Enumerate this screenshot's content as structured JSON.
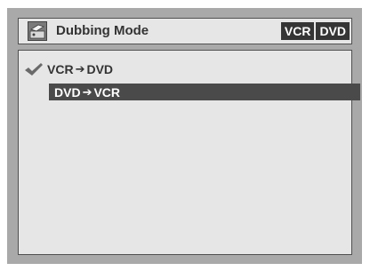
{
  "header": {
    "title": "Dubbing Mode",
    "icon": "dubbing-icon",
    "badges": [
      "VCR",
      "DVD"
    ]
  },
  "options": [
    {
      "from": "VCR",
      "to": "DVD",
      "arrow": "➔",
      "checked": true,
      "highlighted": false
    },
    {
      "from": "DVD",
      "to": "VCR",
      "arrow": "➔",
      "checked": false,
      "highlighted": true
    }
  ],
  "colors": {
    "frame": "#a9a9a9",
    "panel": "#e6e6e6",
    "highlight": "#4a4a4a",
    "badge": "#353535"
  }
}
